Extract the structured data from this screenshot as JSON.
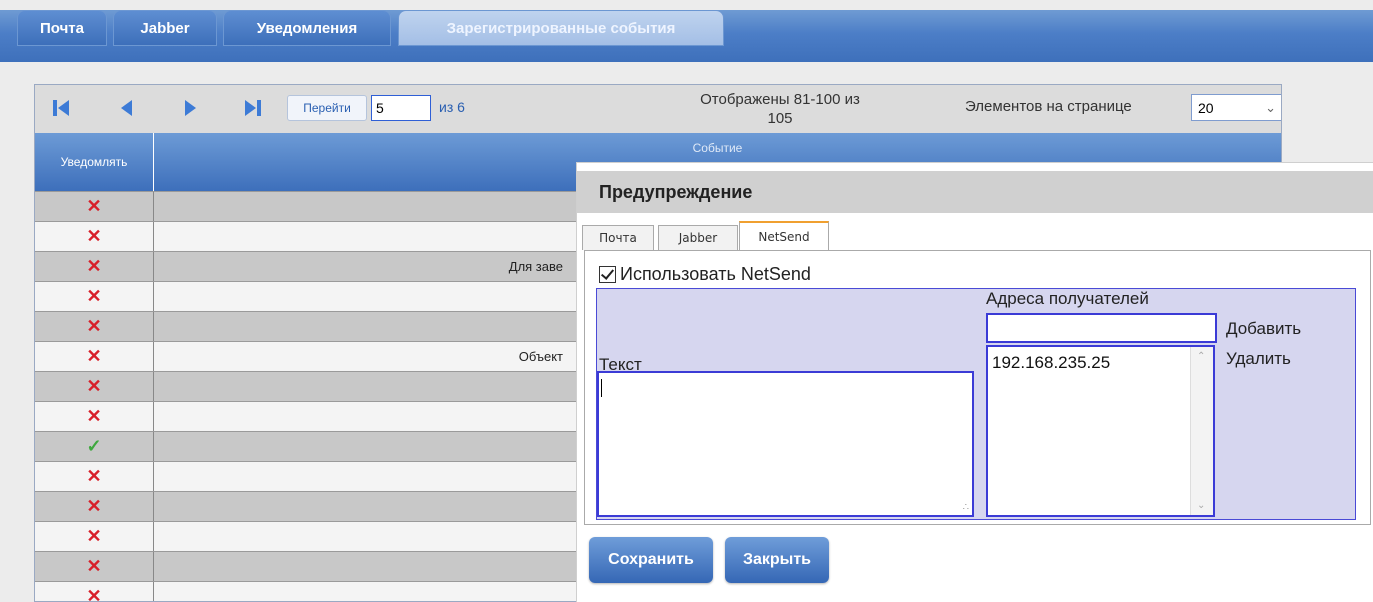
{
  "tabs": [
    {
      "label": "Почта"
    },
    {
      "label": "Jabber"
    },
    {
      "label": "Уведомления"
    },
    {
      "label": "Зарегистрированные события",
      "active": true
    }
  ],
  "pager": {
    "go_label": "Перейти",
    "page_value": "5",
    "of_text": "из 6",
    "shown_line1": "Отображены 81-100 из",
    "shown_line2": "105",
    "per_page_label": "Элементов на странице",
    "per_page_value": "20"
  },
  "table": {
    "columns": [
      "Уведомлять",
      "Событие"
    ],
    "rows": [
      {
        "notify": "x",
        "event": ""
      },
      {
        "notify": "x",
        "event": ""
      },
      {
        "notify": "x",
        "event": "Для заве"
      },
      {
        "notify": "x",
        "event": ""
      },
      {
        "notify": "x",
        "event": ""
      },
      {
        "notify": "x",
        "event": "Объект"
      },
      {
        "notify": "x",
        "event": ""
      },
      {
        "notify": "x",
        "event": ""
      },
      {
        "notify": "check",
        "event": ""
      },
      {
        "notify": "x",
        "event": ""
      },
      {
        "notify": "x",
        "event": ""
      },
      {
        "notify": "x",
        "event": ""
      },
      {
        "notify": "x",
        "event": ""
      },
      {
        "notify": "x",
        "event": ""
      }
    ]
  },
  "dialog": {
    "title": "Предупреждение",
    "tabs": [
      "Почта",
      "Jabber",
      "NetSend"
    ],
    "use_label": "Использовать NetSend",
    "text_label": "Текст",
    "text_value": "",
    "addresses_label": "Адреса получателей",
    "address_input": "",
    "addresses": [
      "192.168.235.25"
    ],
    "add_label": "Добавить",
    "remove_label": "Удалить",
    "save_label": "Сохранить",
    "close_label": "Закрыть"
  },
  "colors": {
    "accent": "#3d6fbb",
    "cross": "#d8202a",
    "check": "#3fa83f",
    "dialog_group": "#d6d6ef"
  }
}
